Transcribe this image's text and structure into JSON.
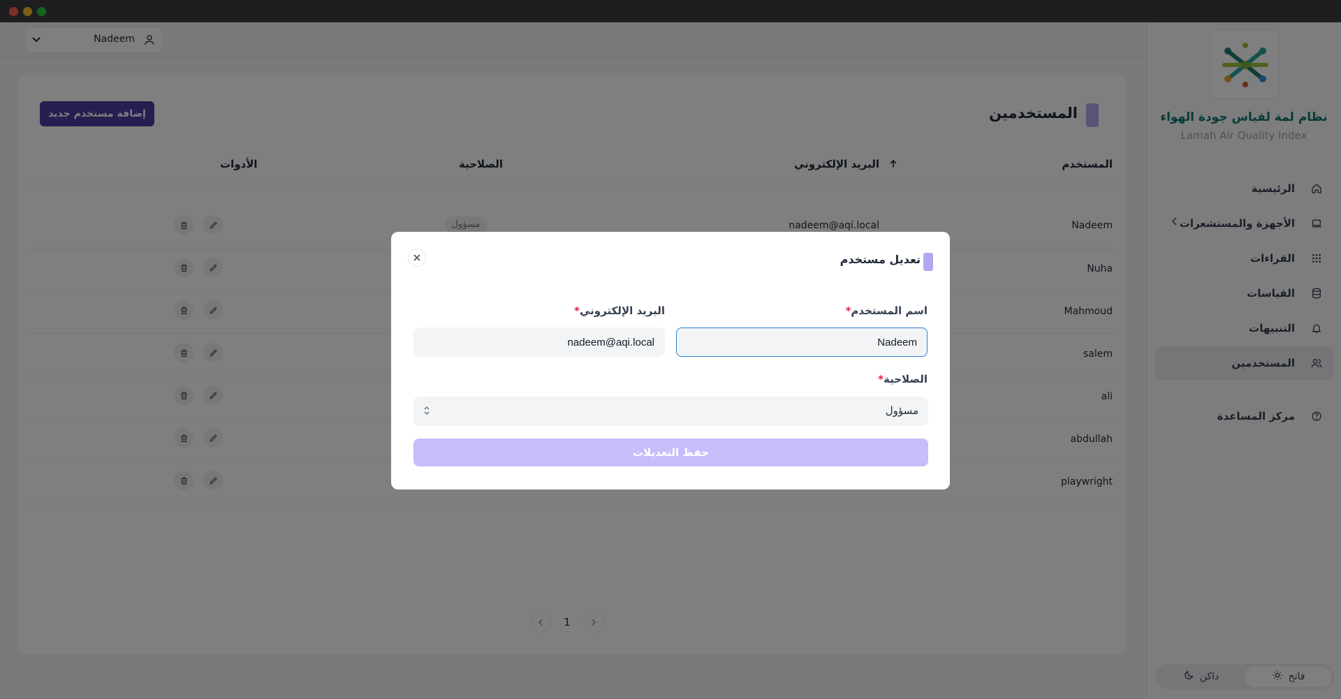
{
  "window": {
    "colors": {
      "close": "#ff5f57",
      "minimize": "#febc2e",
      "maximize": "#28c840"
    }
  },
  "sidebar": {
    "app_title": "نظام لمة لقياس جودة الهواء",
    "app_subtitle": "Lamah Air Quality Index",
    "items": [
      {
        "label": "الرئيسية",
        "icon": "home-icon"
      },
      {
        "label": "الأجهزة والمستشعرات",
        "icon": "laptop-icon",
        "expandable": true
      },
      {
        "label": "القراءات",
        "icon": "grid-icon"
      },
      {
        "label": "القياسات",
        "icon": "database-icon"
      },
      {
        "label": "التنبيهات",
        "icon": "bell-icon"
      },
      {
        "label": "المستخدمين",
        "icon": "users-icon",
        "active": true
      },
      {
        "label": "مركز المساعدة",
        "icon": "help-circle-icon"
      }
    ],
    "theme": {
      "light": "فاتح",
      "dark": "داكن",
      "selected": "light"
    }
  },
  "topbar": {
    "user_name": "Nadeem"
  },
  "page": {
    "title": "المستخدمين",
    "add_button": "إضافة مستخدم جديد",
    "columns": {
      "user": "المستخدم",
      "email": "البريد الإلكتروني",
      "role": "الصلاحية",
      "tools": "الأدوات"
    },
    "rows": [
      {
        "user": "Nadeem",
        "email": "nadeem@aqi.local",
        "role": "مسؤول"
      },
      {
        "user": "Nuha"
      },
      {
        "user": "Mahmoud"
      },
      {
        "user": "salem"
      },
      {
        "user": "ali"
      },
      {
        "user": "abdullah"
      },
      {
        "user": "playwright"
      }
    ],
    "pagination": {
      "current": "1"
    }
  },
  "modal": {
    "title": "تعديل مستخدم",
    "username_label": "اسم المستخدم",
    "email_label": "البريد الإلكتروني",
    "role_label": "الصلاحية",
    "required_mark": "*",
    "username_value": "Nadeem",
    "email_value": "nadeem@aqi.local",
    "role_value": "مسؤول",
    "save_button": "حفظ التعديلات"
  },
  "colors": {
    "accent": "#4c3aa0",
    "accent_light": "#b3a7f0",
    "brand_teal": "#0f766e"
  }
}
